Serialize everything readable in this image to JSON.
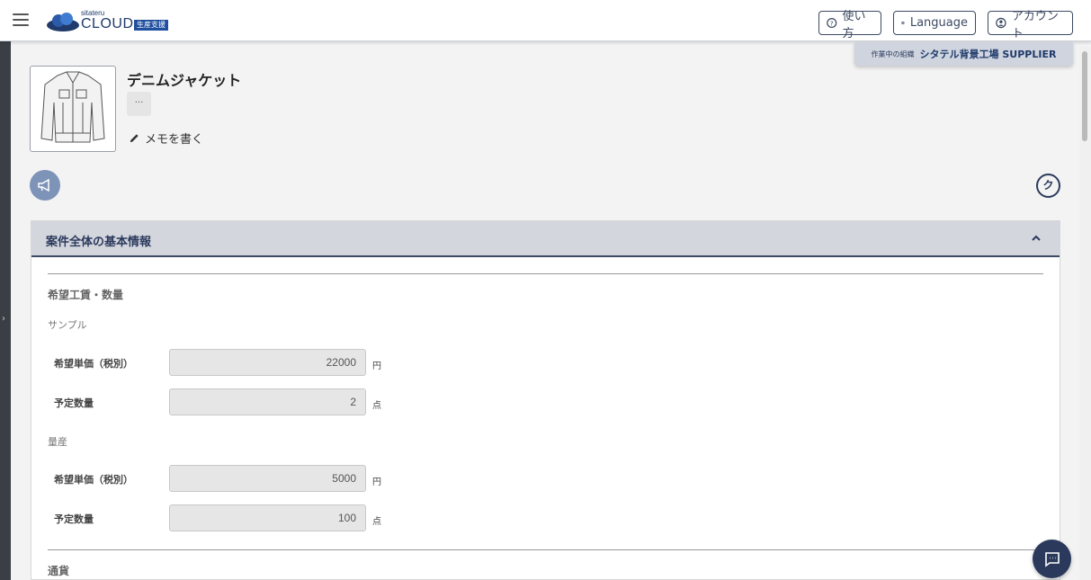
{
  "header": {
    "logo_small": "sitateru",
    "logo_main": "CLOUD",
    "logo_badge": "生産支援",
    "help_label": "使い方",
    "language_label": "Language",
    "account_label": "アカウント"
  },
  "org": {
    "label": "作業中の組織",
    "name": "シタテル背景工場 SUPPLIER"
  },
  "product": {
    "title": "デニムジャケット",
    "more": "···",
    "memo": "メモを書く",
    "k_button": "ク"
  },
  "panel": {
    "title": "案件全体の基本情報",
    "section_title": "希望工賃・数量",
    "sample": {
      "title": "サンプル",
      "price_label": "希望単価（税別）",
      "price_value": "22000",
      "price_unit": "円",
      "qty_label": "予定数量",
      "qty_value": "2",
      "qty_unit": "点"
    },
    "mass": {
      "title": "量産",
      "price_label": "希望単価（税別）",
      "price_value": "5000",
      "price_unit": "円",
      "qty_label": "予定数量",
      "qty_value": "100",
      "qty_unit": "点"
    },
    "currency_title": "通貨"
  }
}
